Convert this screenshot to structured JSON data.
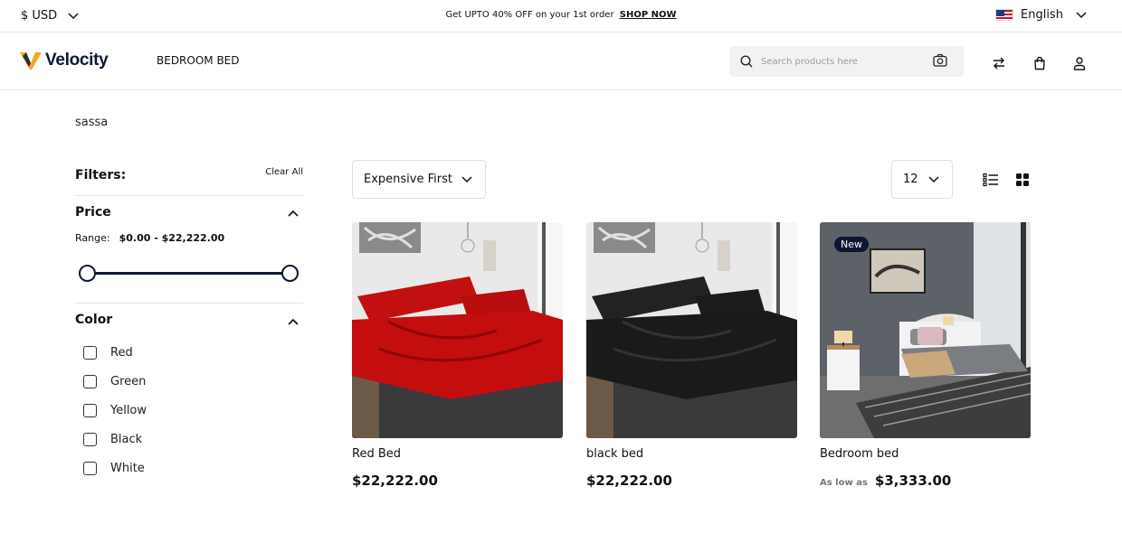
{
  "topbar": {
    "currency": "$ USD",
    "promo_text": "Get UPTO 40% OFF on your 1st order",
    "promo_link": "SHOP NOW",
    "language": "English"
  },
  "header": {
    "logo_text": "Velocity",
    "nav": [
      "BEDROOM BED"
    ],
    "search_placeholder": "Search products here"
  },
  "page": {
    "title": "sassa"
  },
  "filters": {
    "title": "Filters:",
    "clear_all": "Clear All",
    "price": {
      "title": "Price",
      "range_label": "Range:",
      "range_value": "$0.00 - $22,222.00",
      "min": 0,
      "max": 22222
    },
    "color": {
      "title": "Color",
      "options": [
        "Red",
        "Green",
        "Yellow",
        "Black",
        "White"
      ]
    }
  },
  "toolbar": {
    "sort": "Expensive First",
    "per_page": "12"
  },
  "products": [
    {
      "name": "Red Bed",
      "price": "$22,222.00",
      "prefix": "",
      "badge": "",
      "sheet_color": "#c40d0d"
    },
    {
      "name": "black bed",
      "price": "$22,222.00",
      "prefix": "",
      "badge": "",
      "sheet_color": "#1a1a1a"
    },
    {
      "name": "Bedroom bed",
      "price": "$3,333.00",
      "prefix": "As low as",
      "badge": "New",
      "sheet_color": "#6b6b6b"
    }
  ],
  "colors": {
    "brand_dark": "#0d1633",
    "logo_accent": "#f5a623"
  }
}
